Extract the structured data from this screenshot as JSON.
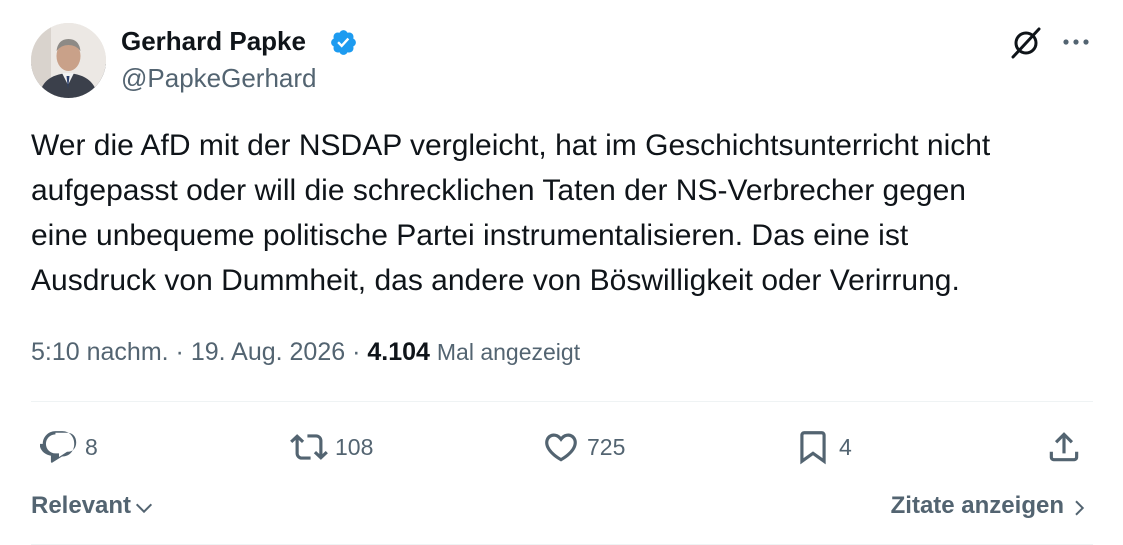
{
  "author": {
    "name": "Gerhard Papke",
    "handle": "@PapkeGerhard",
    "verified": true
  },
  "tweet": {
    "text": "Wer die AfD mit der NSDAP vergleicht, hat im Geschichtsunterricht nicht\naufgepasst oder will die schrecklichen Taten  der NS-Verbrecher gegen\neine unbequeme politische Partei instrumentalisieren. Das eine ist\nAusdruck von Dummheit, das andere von Böswilligkeit oder Verirrung.",
    "time": "5:10 nachm.",
    "separator": "·",
    "date": "19. Aug. 2026",
    "views_count": "4.104",
    "views_label": "Mal angezeigt"
  },
  "actions": {
    "replies": "8",
    "reposts": "108",
    "likes": "725",
    "bookmarks": "4"
  },
  "footer": {
    "sort_label": "Relevant",
    "quotes_label": "Zitate anzeigen"
  },
  "colors": {
    "text": "#0f1419",
    "secondary": "#536471",
    "verified": "#1d9bf0",
    "divider": "#eff3f4"
  },
  "icons": [
    "grok-icon",
    "more-icon",
    "reply-icon",
    "repost-icon",
    "like-icon",
    "bookmark-icon",
    "share-icon",
    "chevron-down-icon",
    "chevron-right-icon",
    "verified-badge-icon"
  ]
}
